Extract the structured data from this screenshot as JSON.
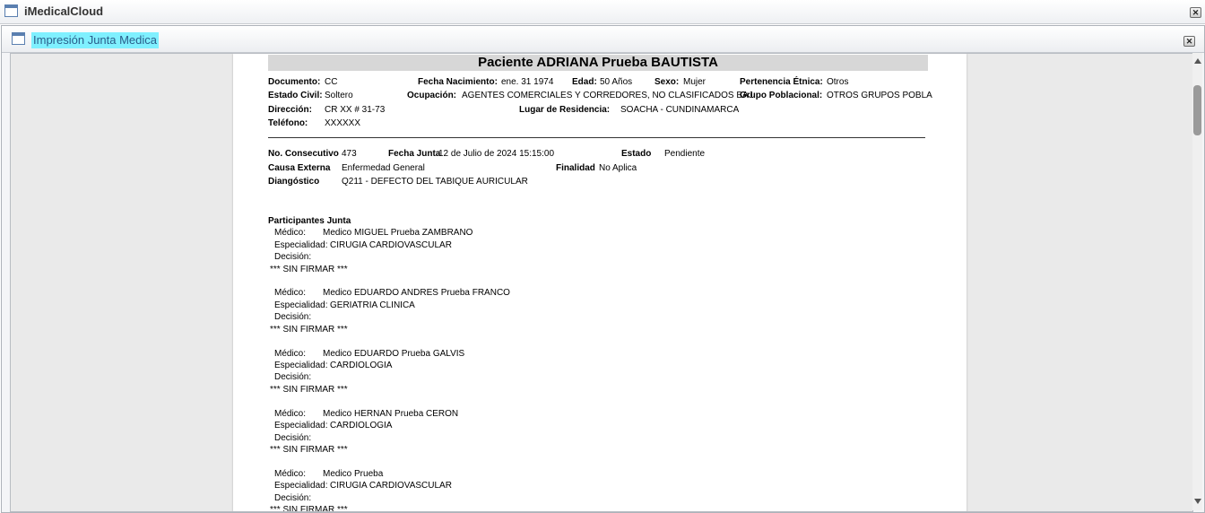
{
  "window": {
    "title": "iMedicalCloud"
  },
  "panel": {
    "title": "Impresión Junta Medica"
  },
  "report": {
    "header": "Paciente ADRIANA Prueba BAUTISTA",
    "labels": {
      "documento": "Documento:",
      "fecha_nacimiento": "Fecha Nacimiento:",
      "edad": "Edad:",
      "sexo": "Sexo:",
      "pertenencia": "Pertenencia Étnica:",
      "estado_civil": "Estado Civil:",
      "ocupacion": "Ocupación:",
      "grupo": "Grupo Poblacional:",
      "direccion": "Dirección:",
      "lugar": "Lugar de Residencia:",
      "telefono": "Teléfono:",
      "consecutivo": "No. Consecutivo",
      "fecha_junta": "Fecha Junta",
      "estado": "Estado",
      "causa": "Causa Externa",
      "finalidad": "Finalidad",
      "diagnostico": "Diangóstico",
      "participantes": "Participantes Junta",
      "medico": "Médico:",
      "especialidad": "Especialidad:",
      "decision": "Decisión:"
    },
    "patient": {
      "documento": "CC",
      "fecha_nacimiento": "ene. 31 1974",
      "edad": "50  Años",
      "sexo": "Mujer",
      "pertenencia": "Otros",
      "estado_civil": "Soltero",
      "ocupacion": "AGENTES COMERCIALES Y CORREDORES, NO CLASIFICADOS BAJ",
      "grupo": "OTROS GRUPOS POBLA",
      "direccion": "CR XX # 31-73",
      "lugar": "SOACHA - CUNDINAMARCA",
      "telefono": "XXXXXX"
    },
    "junta": {
      "consecutivo": "473",
      "fecha_junta": "12 de Julio de 2024 15:15:00",
      "estado": "Pendiente",
      "causa": "Enfermedad General",
      "finalidad": "No Aplica",
      "diagnostico": "Q211 - DEFECTO DEL TABIQUE AURICULAR"
    },
    "participants": [
      {
        "medico": "Medico MIGUEL Prueba ZAMBRANO",
        "especialidad": "CIRUGIA CARDIOVASCULAR",
        "decision": "",
        "firma": "*** SIN FIRMAR ***"
      },
      {
        "medico": "Medico EDUARDO ANDRES Prueba FRANCO",
        "especialidad": "GERIATRIA CLINICA",
        "decision": "",
        "firma": "*** SIN FIRMAR ***"
      },
      {
        "medico": "Medico EDUARDO Prueba GALVIS",
        "especialidad": "CARDIOLOGIA",
        "decision": "",
        "firma": "*** SIN FIRMAR ***"
      },
      {
        "medico": "Medico HERNAN Prueba CERON",
        "especialidad": "CARDIOLOGIA",
        "decision": "",
        "firma": "*** SIN FIRMAR ***"
      },
      {
        "medico": "Medico Prueba",
        "especialidad": "CIRUGIA CARDIOVASCULAR",
        "decision": "",
        "firma": "*** SIN FIRMAR ***"
      }
    ]
  }
}
